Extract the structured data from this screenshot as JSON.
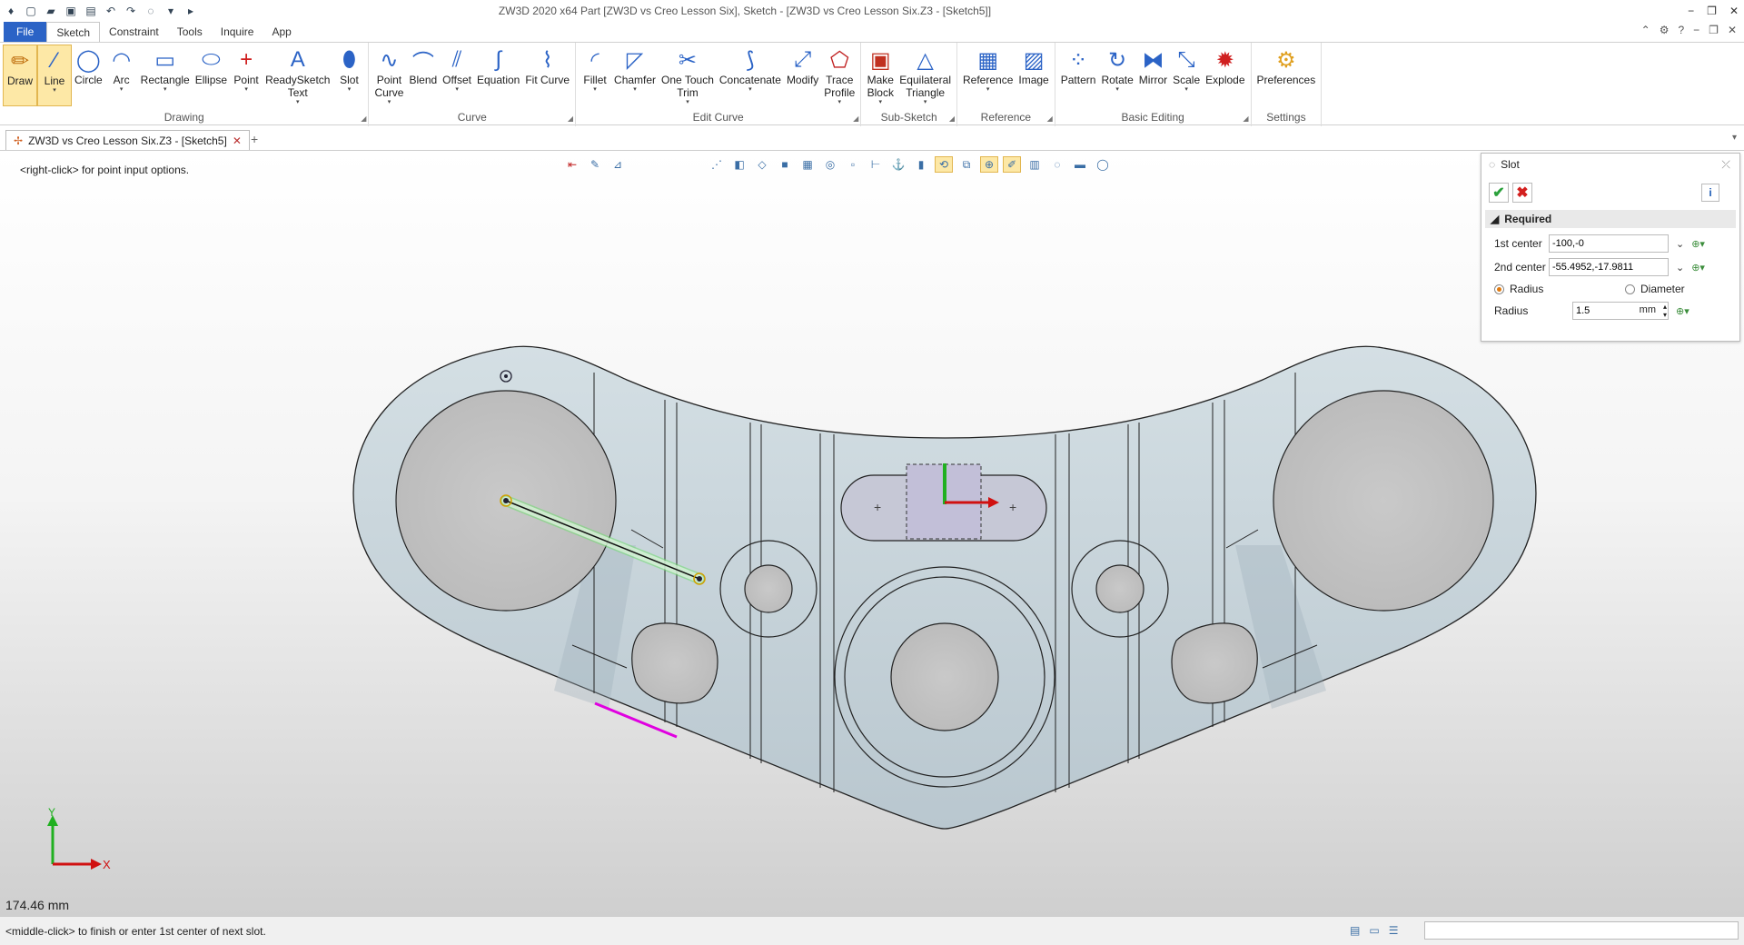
{
  "app": {
    "title": "ZW3D 2020 x64      Part [ZW3D vs Creo Lesson Six],  Sketch - [ZW3D vs Creo Lesson Six.Z3 - [Sketch5]]",
    "quick_access_icons": [
      "app-logo-icon",
      "new-icon",
      "open-icon",
      "save-icon",
      "print-icon",
      "undo-icon",
      "redo-icon",
      "selection-icon",
      "dropdown-icon",
      "play-icon"
    ],
    "window_controls": [
      "−",
      "❐",
      "✕"
    ]
  },
  "menu": {
    "tabs": [
      "File",
      "Sketch",
      "Constraint",
      "Tools",
      "Inquire",
      "App"
    ],
    "active": "Sketch"
  },
  "ribbon": {
    "groups": [
      {
        "label": "Drawing",
        "buttons": [
          {
            "label": "Draw",
            "icon": "draw-pencil-icon",
            "selected": true
          },
          {
            "label": "Line",
            "icon": "line-icon",
            "selected": true,
            "caret": true
          },
          {
            "label": "Circle",
            "icon": "circle-icon"
          },
          {
            "label": "Arc",
            "icon": "arc-icon",
            "caret": true
          },
          {
            "label": "Rectangle",
            "icon": "rectangle-icon",
            "caret": true
          },
          {
            "label": "Ellipse",
            "icon": "ellipse-icon"
          },
          {
            "label": "Point",
            "icon": "point-icon",
            "caret": true
          },
          {
            "label": "ReadySketch\nText",
            "icon": "text-icon",
            "caret": true
          },
          {
            "label": "Slot",
            "icon": "slot-icon",
            "caret": true
          }
        ]
      },
      {
        "label": "Curve",
        "buttons": [
          {
            "label": "Point\nCurve",
            "icon": "point-curve-icon",
            "caret": true
          },
          {
            "label": "Blend",
            "icon": "blend-icon"
          },
          {
            "label": "Offset",
            "icon": "offset-icon",
            "caret": true
          },
          {
            "label": "Equation",
            "icon": "equation-icon"
          },
          {
            "label": "Fit Curve",
            "icon": "fit-curve-icon"
          }
        ]
      },
      {
        "label": "Edit Curve",
        "buttons": [
          {
            "label": "Fillet",
            "icon": "fillet-icon",
            "caret": true
          },
          {
            "label": "Chamfer",
            "icon": "chamfer-icon",
            "caret": true
          },
          {
            "label": "One Touch\nTrim",
            "icon": "trim-icon",
            "caret": true
          },
          {
            "label": "Concatenate",
            "icon": "concatenate-icon",
            "caret": true
          },
          {
            "label": "Modify",
            "icon": "modify-icon"
          },
          {
            "label": "Trace\nProfile",
            "icon": "trace-profile-icon",
            "caret": true
          }
        ]
      },
      {
        "label": "Sub-Sketch",
        "buttons": [
          {
            "label": "Make\nBlock",
            "icon": "make-block-icon",
            "caret": true
          },
          {
            "label": "Equilateral\nTriangle",
            "icon": "triangle-icon",
            "caret": true
          }
        ]
      },
      {
        "label": "Reference",
        "buttons": [
          {
            "label": "Reference",
            "icon": "reference-icon",
            "caret": true
          },
          {
            "label": "Image",
            "icon": "image-icon"
          }
        ]
      },
      {
        "label": "Basic Editing",
        "buttons": [
          {
            "label": "Pattern",
            "icon": "pattern-icon"
          },
          {
            "label": "Rotate",
            "icon": "rotate-icon",
            "caret": true
          },
          {
            "label": "Mirror",
            "icon": "mirror-icon"
          },
          {
            "label": "Scale",
            "icon": "scale-icon",
            "caret": true
          },
          {
            "label": "Explode",
            "icon": "explode-icon"
          }
        ]
      },
      {
        "label": "Settings",
        "buttons": [
          {
            "label": "Preferences",
            "icon": "preferences-icon"
          }
        ]
      }
    ]
  },
  "doc_tab": {
    "label": "ZW3D vs Creo Lesson Six.Z3 - [Sketch5]",
    "close": "✕",
    "add": "+"
  },
  "viewport": {
    "hint": "<right-click> for point input options.",
    "measure": "174.46 mm",
    "axis_x": "X",
    "axis_y": "Y"
  },
  "slot_panel": {
    "title": "Slot",
    "section": "Required",
    "first_center_label": "1st center",
    "first_center_value": "-100,-0",
    "second_center_label": "2nd center",
    "second_center_value": "-55.4952,-17.9811",
    "radius_option": "Radius",
    "diameter_option": "Diameter",
    "radius_label": "Radius",
    "radius_value": "1.5",
    "unit": "mm",
    "radius_selected": true
  },
  "status": {
    "message": "<middle-click> to finish or enter 1st center of next slot."
  },
  "colors": {
    "accent": "#2b63c6",
    "part_fill": "#ccd8de",
    "selection": "#fde8a6",
    "preview_green": "#3fbf3f",
    "highlight_magenta": "#e000e0"
  }
}
